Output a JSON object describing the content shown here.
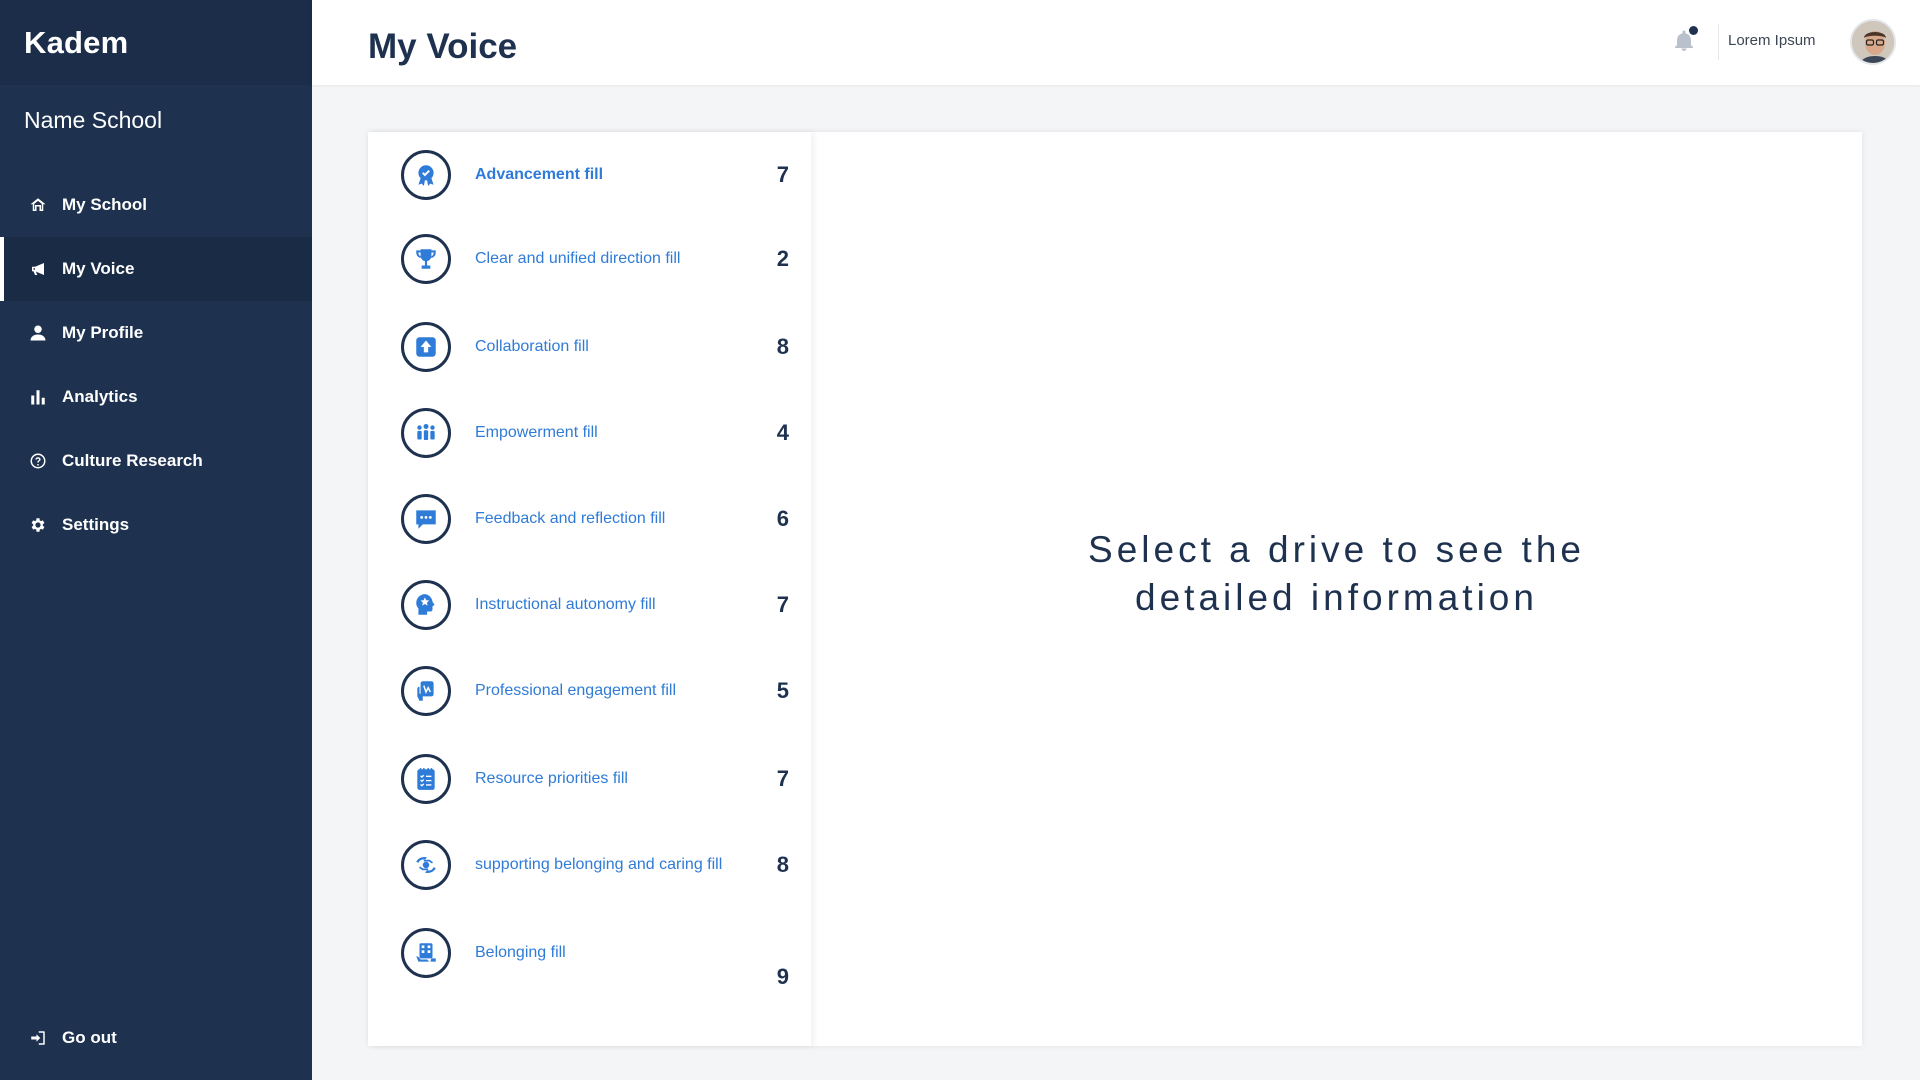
{
  "sidebar": {
    "brand": "Kadem",
    "school_name": "Name School",
    "items": [
      {
        "label": "My School",
        "icon": "home-icon",
        "active": false
      },
      {
        "label": "My Voice",
        "icon": "megaphone-icon",
        "active": true
      },
      {
        "label": "My Profile",
        "icon": "user-icon",
        "active": false
      },
      {
        "label": "Analytics",
        "icon": "bar-chart-icon",
        "active": false
      },
      {
        "label": "Culture Research",
        "icon": "question-circle-icon",
        "active": false
      },
      {
        "label": "Settings",
        "icon": "gear-icon",
        "active": false
      }
    ],
    "logout": {
      "label": "Go out",
      "icon": "sign-out-icon"
    }
  },
  "header": {
    "title": "My Voice",
    "username": "Lorem Ipsum",
    "notification_icon": "bell-icon",
    "has_unread": true
  },
  "drives": [
    {
      "label": "Advancement fill",
      "count": "7",
      "icon": "award-badge-icon",
      "selected": true
    },
    {
      "label": "Clear and unified direction fill",
      "count": "2",
      "icon": "trophy-icon",
      "selected": false
    },
    {
      "label": "Collaboration fill",
      "count": "8",
      "icon": "upload-arrow-icon",
      "selected": false
    },
    {
      "label": "Empowerment fill",
      "count": "4",
      "icon": "group-icon",
      "selected": false
    },
    {
      "label": "Feedback and reflection fill",
      "count": "6",
      "icon": "chat-bubble-icon",
      "selected": false
    },
    {
      "label": "Instructional autonomy fill",
      "count": "7",
      "icon": "head-star-icon",
      "selected": false
    },
    {
      "label": "Professional engagement fill",
      "count": "5",
      "icon": "hand-card-icon",
      "selected": false
    },
    {
      "label": "Resource priorities fill",
      "count": "7",
      "icon": "checklist-icon",
      "selected": false
    },
    {
      "label": "supporting belonging and caring fill",
      "count": "8",
      "icon": "caring-hands-icon",
      "selected": false
    },
    {
      "label": "Belonging fill",
      "count": "9",
      "icon": "building-icon",
      "selected": false
    }
  ],
  "detail": {
    "placeholder": "Select a drive to see the detailed information"
  },
  "colors": {
    "sidebar_bg": "#1e3250",
    "accent_blue": "#2f7bd8",
    "navy": "#1e3250"
  }
}
